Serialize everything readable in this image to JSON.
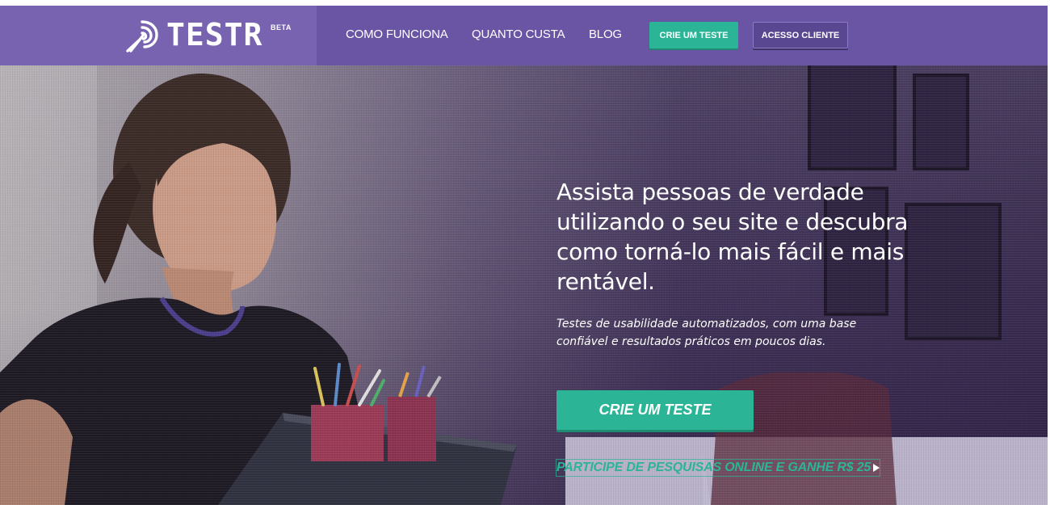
{
  "brand": {
    "logo_text": "TESTR",
    "badge": "BETA",
    "logo_icon": "testr-swirl-icon"
  },
  "nav": {
    "links": [
      {
        "label": "COMO FUNCIONA"
      },
      {
        "label": "QUANTO CUSTA"
      },
      {
        "label": "BLOG"
      }
    ],
    "primary_button": "CRIE UM TESTE",
    "secondary_button": "ACESSO CLIENTE"
  },
  "hero": {
    "headline": "Assista pessoas de verdade utilizando o seu site e descubra como torná-lo mais fácil e mais rentável.",
    "subtext": "Testes de usabilidade automatizados, com uma base confiável e resultados práticos em poucos dias.",
    "cta_label": "CRIE UM TESTE",
    "survey_link": "PARTICIPE DE PESQUISAS ONLINE E GANHE R$ 25"
  },
  "colors": {
    "nav_bg": "#6a55a5",
    "logo_bg": "#7763b0",
    "accent": "#2bb596",
    "secondary_btn": "#5a4791"
  }
}
